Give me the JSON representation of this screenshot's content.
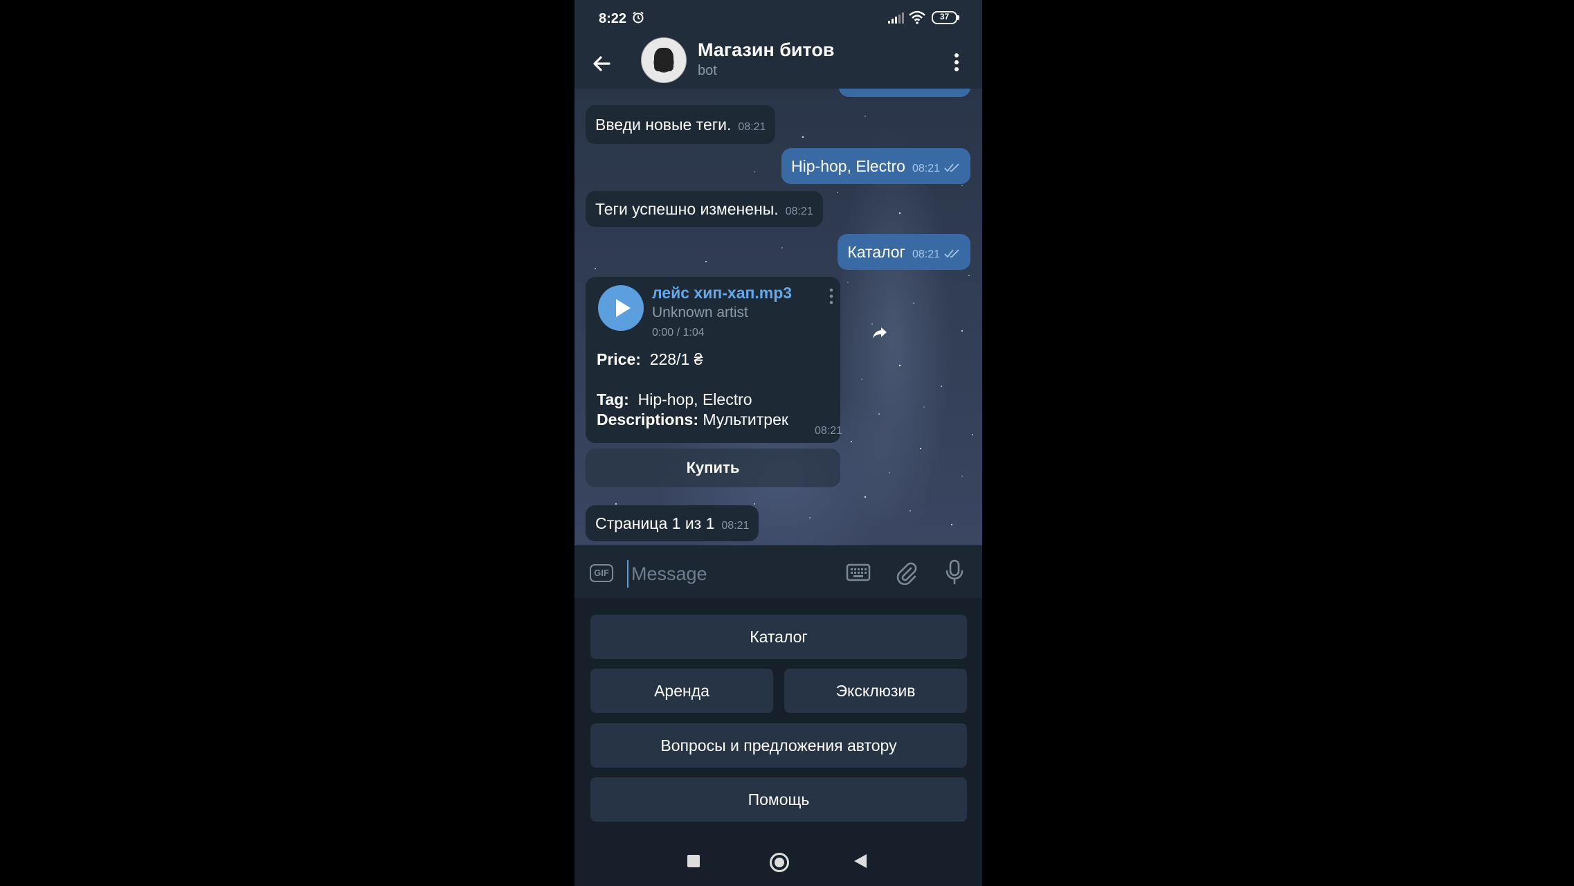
{
  "status_bar": {
    "time": "8:22",
    "battery": "37"
  },
  "header": {
    "title": "Магазин битов",
    "subtitle": "bot"
  },
  "messages": [
    {
      "text": "Введи новые теги.",
      "time": "08:21"
    },
    {
      "text": "Hip-hop, Electro",
      "time": "08:21"
    },
    {
      "text": "Теги успешно изменены.",
      "time": "08:21"
    },
    {
      "text": "Каталог",
      "time": "08:21"
    }
  ],
  "audio_message": {
    "title": "лейс хип-хап.mp3",
    "artist": "Unknown artist",
    "duration": "0:00 / 1:04",
    "price_label": "Price:",
    "price_value": "228/1 ₴",
    "tag_label": "Tag:",
    "tag_value": "Hip-hop, Electro",
    "desc_label": "Descriptions:",
    "desc_value": "Мультитрек",
    "time": "08:21",
    "inline_button": "Купить"
  },
  "page_message": {
    "text": "Страница 1 из 1",
    "time": "08:21"
  },
  "input": {
    "placeholder": "Message",
    "gif_label": "GIF"
  },
  "reply_keyboard": {
    "catalog": "Каталог",
    "rent": "Аренда",
    "exclusive": "Эксклюзив",
    "questions": "Вопросы и предложения автору",
    "help": "Помощь"
  },
  "colors": {
    "accent": "#5b9fde",
    "outgoing_bubble": "#3a6aa3",
    "incoming_bubble": "#1e2936",
    "header_bg": "#212d3b"
  }
}
